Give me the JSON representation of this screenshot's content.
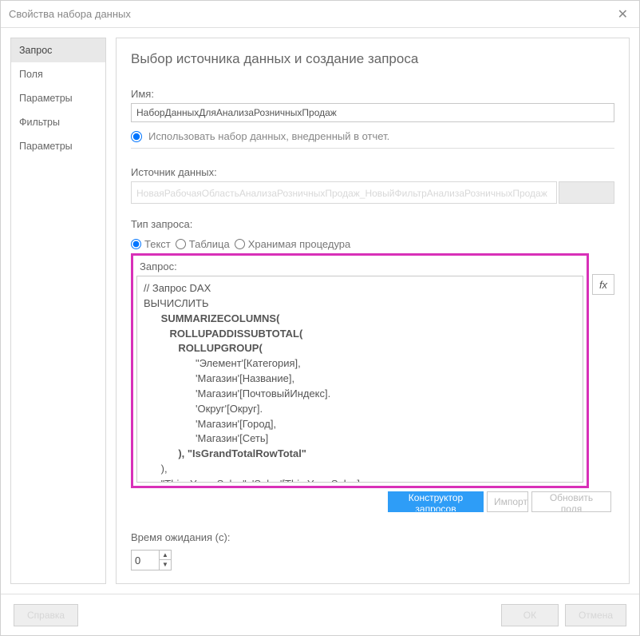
{
  "title": "Свойства набора данных",
  "sidebar": {
    "items": [
      {
        "label": "Запрос",
        "active": true
      },
      {
        "label": "Поля"
      },
      {
        "label": "Параметры"
      },
      {
        "label": "Фильтры"
      },
      {
        "label": "Параметры"
      }
    ]
  },
  "main": {
    "heading": "Выбор источника данных и создание запроса",
    "name_label": "Имя:",
    "name_value": "НаборДанныхДляАнализаРозничныхПродаж",
    "embed_label": "Использовать набор данных, внедренный в отчет.",
    "ds_label": "Источник данных:",
    "ds_value": "НоваяРабочаяОбластьАнализаРозничныхПродаж_НовыйФильтрАнализаРозничныхПродаж",
    "qt_label": "Тип запроса:",
    "qt_options": [
      "Текст",
      "Таблица",
      "Хранимая процедура"
    ],
    "query_label": "Запрос:",
    "query_text": "// Запрос DAX\nВЫЧИСЛИТЬ\n      SUMMARIZECOLUMNS(\n         ROLLUPADDISSUBTOTAL(\n            ROLLUPGROUP(\n                  \"Элемент'[Категория],\n                  'Магазин'[Название],\n                  'Магазин'[ПочтовыйИндекс].\n                  'Округ'[Округ].\n                  'Магазин'[Город],\n                  'Магазин'[Сеть]\n            ), \"IsGrandTotalRowTotal\"\n      ),\n      \"This_Year_Sales\", 'Sales'[This Year Sales]",
    "fx_label": "fx",
    "btn_designer": "Конструктор запросов",
    "btn_import": "Импорт",
    "btn_refresh": "Обновить поля",
    "timeout_label": "Время ожидания (с):",
    "timeout_value": "0"
  },
  "footer": {
    "help": "Справка",
    "ok": "ОК",
    "cancel": "Отмена"
  }
}
